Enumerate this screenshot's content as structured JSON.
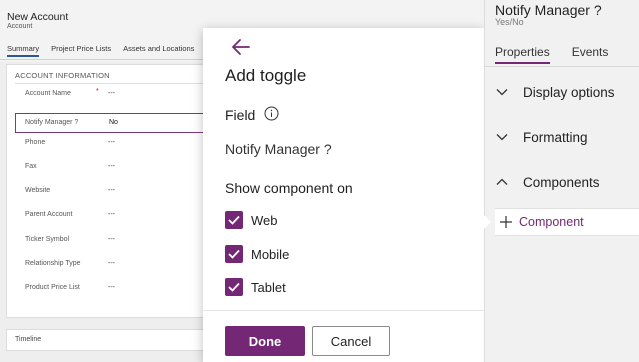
{
  "form": {
    "title": "New Account",
    "entity": "Account",
    "tabs": [
      {
        "label": "Summary",
        "active": true
      },
      {
        "label": "Project Price Lists",
        "active": false
      },
      {
        "label": "Assets and Locations",
        "active": false
      }
    ],
    "section_title": "ACCOUNT INFORMATION",
    "fields": [
      {
        "label": "Account Name",
        "value": "---",
        "required": "*"
      },
      {
        "label": "Notify Manager ?",
        "value": "No"
      },
      {
        "label": "Phone",
        "value": "---"
      },
      {
        "label": "Fax",
        "value": "---"
      },
      {
        "label": "Website",
        "value": "---"
      },
      {
        "label": "Parent Account",
        "value": "---"
      },
      {
        "label": "Ticker Symbol",
        "value": "---"
      },
      {
        "label": "Relationship Type",
        "value": "---"
      },
      {
        "label": "Product Price List",
        "value": "---"
      }
    ],
    "timeline_label": "Timeline"
  },
  "dialog": {
    "back_icon": "arrow-left-icon",
    "title": "Add toggle",
    "field_label": "Field",
    "info_icon": "info-icon",
    "field_value": "Notify Manager ?",
    "show_on_label": "Show component on",
    "options": [
      {
        "label": "Web",
        "checked": true
      },
      {
        "label": "Mobile",
        "checked": true
      },
      {
        "label": "Tablet",
        "checked": true
      }
    ],
    "done_label": "Done",
    "cancel_label": "Cancel"
  },
  "pane": {
    "title": "Notify Manager ?",
    "subtitle": "Yes/No",
    "tabs": [
      {
        "label": "Properties",
        "active": true
      },
      {
        "label": "Events",
        "active": false
      }
    ],
    "sections": [
      {
        "label": "Display options",
        "expanded": false
      },
      {
        "label": "Formatting",
        "expanded": false
      },
      {
        "label": "Components",
        "expanded": true
      }
    ],
    "component_button": "Component"
  },
  "colors": {
    "accent": "#742774",
    "tab_underline": "#2b579a"
  }
}
